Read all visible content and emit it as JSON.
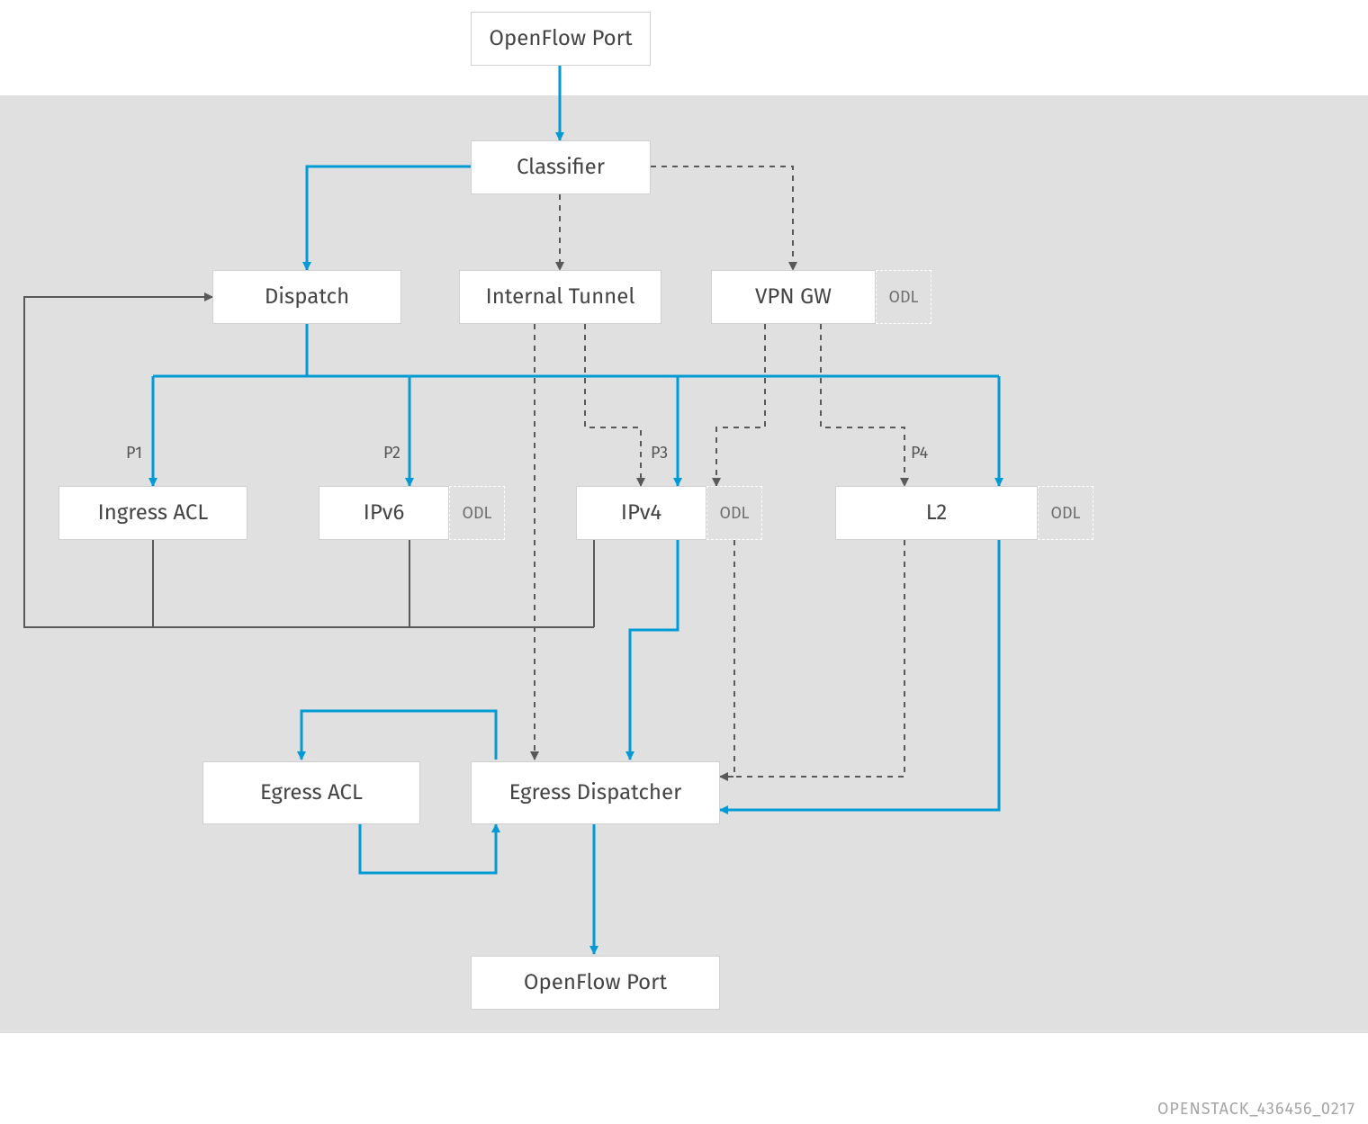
{
  "boxes": {
    "openflow_top": "OpenFlow Port",
    "classifier": "Classifier",
    "dispatch": "Dispatch",
    "internal_tunnel": "Internal Tunnel",
    "vpn_gw": "VPN GW",
    "ingress_acl": "Ingress ACL",
    "ipv6": "IPv6",
    "ipv4": "IPv4",
    "l2": "L2",
    "egress_acl": "Egress ACL",
    "egress_dispatcher": "Egress Dispatcher",
    "openflow_bottom": "OpenFlow Port"
  },
  "tags": {
    "odl": "ODL"
  },
  "labels": {
    "p1": "P1",
    "p2": "P2",
    "p3": "P3",
    "p4": "P4"
  },
  "colors": {
    "blue": "#009bd5",
    "darkgrey": "#595959"
  },
  "footer": "OPENSTACK_436456_0217"
}
